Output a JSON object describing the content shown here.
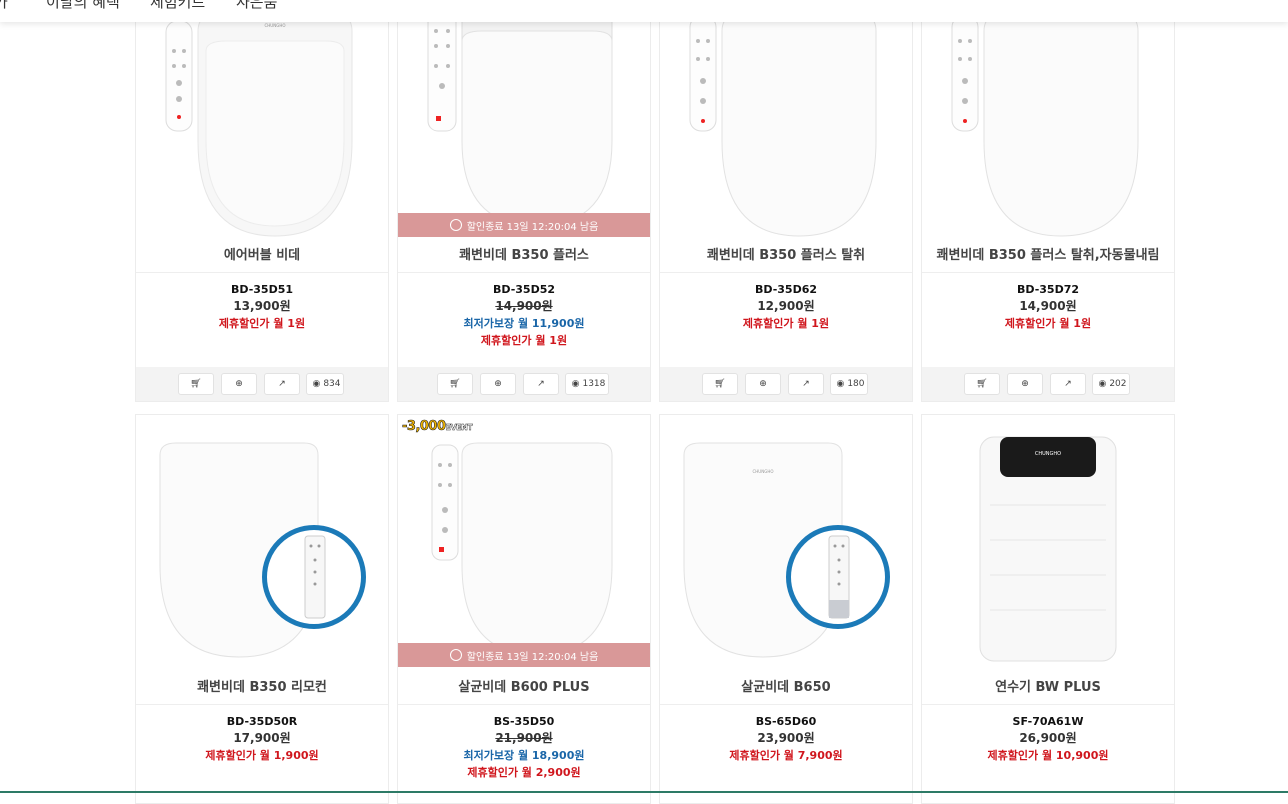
{
  "topnav": {
    "items": [
      "카",
      "이달의 혜택",
      "체험키트",
      "사은품"
    ]
  },
  "timer_text": "할인종료 13일 12:20:04 남음",
  "event_badge": {
    "amount": "-3,000",
    "word": "EVENT"
  },
  "action_icons": [
    "cart-icon",
    "zoom-icon",
    "external-link-icon",
    "eye-icon"
  ],
  "row1": [
    {
      "name": "에어버블 비데",
      "model": "BD-35D51",
      "price": "13,900원",
      "partner": "제휴할인가 월 1원",
      "views": "834"
    },
    {
      "name": "쾌변비데 B350 플러스",
      "model": "BD-35D52",
      "price": "14,900원",
      "best": "최저가보장 월 11,900원",
      "partner": "제휴할인가 월 1원",
      "views": "1318"
    },
    {
      "name": "쾌변비데 B350 플러스 탈취",
      "model": "BD-35D62",
      "price": "12,900원",
      "partner": "제휴할인가 월 1원",
      "views": "180"
    },
    {
      "name": "쾌변비데 B350 플러스 탈취,자동물내림",
      "model": "BD-35D72",
      "price": "14,900원",
      "partner": "제휴할인가 월 1원",
      "views": "202"
    }
  ],
  "row2": [
    {
      "name": "쾌변비데 B350 리모컨",
      "model": "BD-35D50R",
      "price": "17,900원",
      "partner": "제휴할인가 월 1,900원"
    },
    {
      "name": "살균비데 B600 PLUS",
      "model": "BS-35D50",
      "price": "21,900원",
      "best": "최저가보장 월 18,900원",
      "partner": "제휴할인가 월 2,900원"
    },
    {
      "name": "살균비데 B650",
      "model": "BS-65D60",
      "price": "23,900원",
      "partner": "제휴할인가 월 7,900원"
    },
    {
      "name": "연수기 BW PLUS",
      "model": "SF-70A61W",
      "price": "26,900원",
      "partner": "제휴할인가 월 10,900원"
    }
  ],
  "logo_text": "CHUNGHO",
  "colors": {
    "partner": "#d0161d",
    "best": "#1a66a8",
    "timer_bg": "#d99898",
    "ring": "#1b7ab8"
  }
}
